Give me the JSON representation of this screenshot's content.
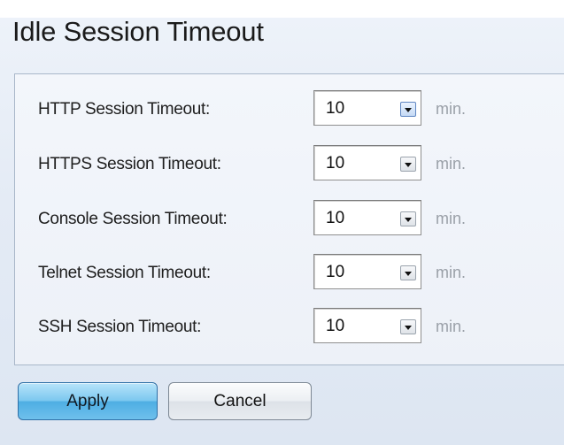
{
  "page": {
    "title": "Idle Session Timeout"
  },
  "timeouts": [
    {
      "label": "HTTP Session Timeout:",
      "value": "10",
      "unit": "min."
    },
    {
      "label": "HTTPS Session Timeout:",
      "value": "10",
      "unit": "min."
    },
    {
      "label": "Console Session Timeout:",
      "value": "10",
      "unit": "min."
    },
    {
      "label": "Telnet Session Timeout:",
      "value": "10",
      "unit": "min."
    },
    {
      "label": "SSH Session Timeout:",
      "value": "10",
      "unit": "min."
    }
  ],
  "actions": {
    "apply_label": "Apply",
    "cancel_label": "Cancel"
  },
  "icons": {
    "dropdown": "chevron-down-icon"
  }
}
